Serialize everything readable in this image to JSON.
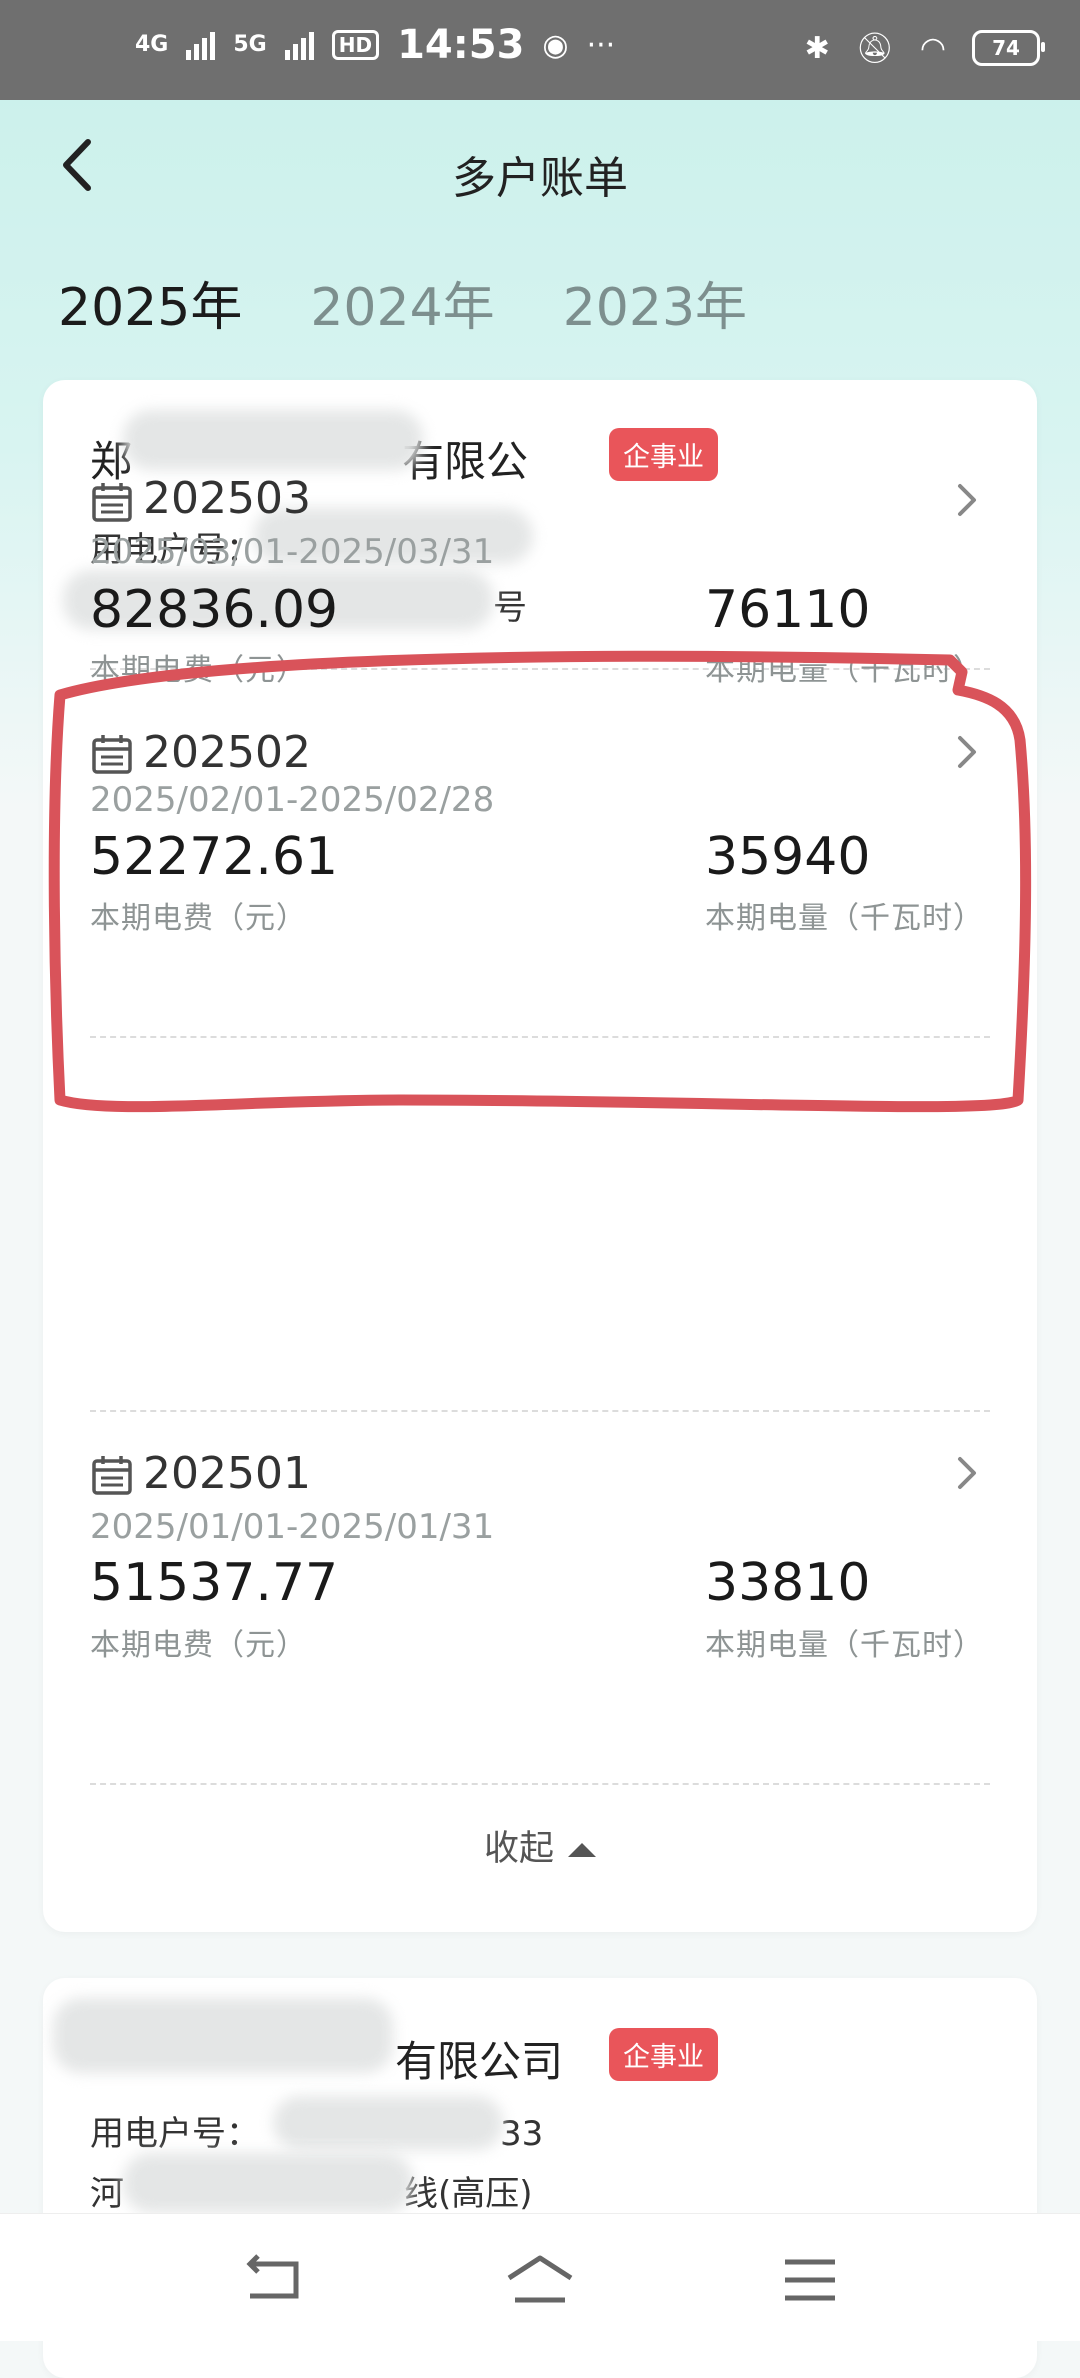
{
  "status_bar": {
    "signal_1": "4G",
    "signal_2": "5G",
    "hd": "HD",
    "time": "14:53",
    "more": "···",
    "battery": "74"
  },
  "nav": {
    "title": "多户账单",
    "back_icon": "back-chevron-icon"
  },
  "tabs": [
    {
      "label": "2025年",
      "active": true
    },
    {
      "label": "2024年",
      "active": false
    },
    {
      "label": "2023年",
      "active": false
    }
  ],
  "account1": {
    "name_prefix": "郑",
    "name_suffix": "有限公",
    "badge": "企事业",
    "meter_label": "用电户号：",
    "address_end": "号",
    "bills": [
      {
        "period": "202503",
        "range": "2025/03/01-2025/03/31",
        "fee": "82836.09",
        "fee_label": "本期电费（元）",
        "usage": "76110",
        "usage_label": "本期电量（千瓦时）"
      },
      {
        "period": "202502",
        "range": "2025/02/01-2025/02/28",
        "fee": "52272.61",
        "fee_label": "本期电费（元）",
        "usage": "35940",
        "usage_label": "本期电量（千瓦时）"
      },
      {
        "period": "202501",
        "range": "2025/01/01-2025/01/31",
        "fee": "51537.77",
        "fee_label": "本期电费（元）",
        "usage": "33810",
        "usage_label": "本期电量（千瓦时）"
      }
    ],
    "collapse_label": "收起"
  },
  "account2": {
    "name_suffix": "有限公司",
    "badge": "企事业",
    "meter_label": "用电户号：",
    "meter_end": "33",
    "address_prefix": "河",
    "address_end": "线(高压)"
  },
  "colors": {
    "accent": "#e9555a",
    "header_bg": "#c9f0ea",
    "annotation": "#d9535a"
  },
  "bottom_nav": [
    "back-icon",
    "home-icon",
    "menu-icon"
  ]
}
